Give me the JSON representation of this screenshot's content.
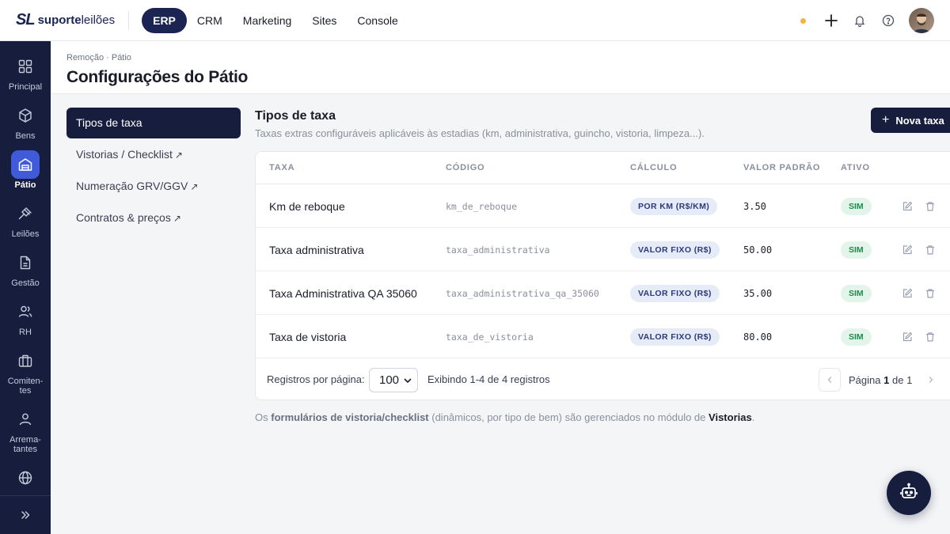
{
  "brand": {
    "mark": "SL",
    "name_bold": "suporte",
    "name_light": "leilões"
  },
  "topnav": {
    "items": [
      {
        "label": "ERP",
        "active": true
      },
      {
        "label": "CRM"
      },
      {
        "label": "Marketing"
      },
      {
        "label": "Sites"
      },
      {
        "label": "Console"
      }
    ]
  },
  "topbar_icons": [
    "status-dot",
    "plus-icon",
    "bell-icon",
    "help-icon",
    "avatar"
  ],
  "sidebar": {
    "items": [
      {
        "label": "Principal",
        "icon": "grid-icon"
      },
      {
        "label": "Bens",
        "icon": "box-icon"
      },
      {
        "label": "Pátio",
        "icon": "warehouse-icon",
        "active": true
      },
      {
        "label": "Leilões",
        "icon": "gavel-icon"
      },
      {
        "label": "Gestão",
        "icon": "document-icon"
      },
      {
        "label": "RH",
        "icon": "users-icon"
      },
      {
        "label": "Comiten-\ntes",
        "icon": "briefcase-icon"
      },
      {
        "label": "Arrema-\ntantes",
        "icon": "user-icon"
      },
      {
        "label": "",
        "icon": "globe-icon"
      }
    ],
    "expand_icon": "double-chevron-right-icon"
  },
  "page": {
    "breadcrumb": "Remoção · Pátio",
    "title": "Configurações do Pátio"
  },
  "submenu": {
    "items": [
      {
        "label": "Tipos de taxa",
        "active": true
      },
      {
        "label": "Vistorias / Checklist",
        "external": "↗"
      },
      {
        "label": "Numeração GRV/GGV",
        "external": "↗"
      },
      {
        "label": "Contratos & preços",
        "external": "↗"
      }
    ]
  },
  "content": {
    "title": "Tipos de taxa",
    "subtitle": "Taxas extras configuráveis aplicáveis às estadias (km, administrativa, guincho, vistoria, limpeza...).",
    "new_button": "Nova taxa"
  },
  "table": {
    "headers": [
      "TAXA",
      "CÓDIGO",
      "CÁLCULO",
      "VALOR PADRÃO",
      "ATIVO"
    ],
    "rows": [
      {
        "name": "Km de reboque",
        "code": "km_de_reboque",
        "calc": "POR KM (R$/KM)",
        "value": "3.50",
        "active": "SIM"
      },
      {
        "name": "Taxa administrativa",
        "code": "taxa_administrativa",
        "calc": "VALOR FIXO (R$)",
        "value": "50.00",
        "active": "SIM"
      },
      {
        "name": "Taxa Administrativa QA 35060",
        "code": "taxa_administrativa_qa_35060",
        "calc": "VALOR FIXO (R$)",
        "value": "35.00",
        "active": "SIM"
      },
      {
        "name": "Taxa de vistoria",
        "code": "taxa_de_vistoria",
        "calc": "VALOR FIXO (R$)",
        "value": "80.00",
        "active": "SIM"
      }
    ]
  },
  "pager": {
    "label": "Registros por página:",
    "per_page": "100",
    "info": "Exibindo 1-4 de 4 registros",
    "page_prefix": "Página",
    "page_current": "1",
    "page_sep": "de",
    "page_total": "1"
  },
  "footnote": {
    "part1": "Os ",
    "bold1": "formulários de vistoria/checklist",
    "part2": " (dinâmicos, por tipo de bem) são gerenciados no módulo de ",
    "link": "Vistorias",
    "part3": "."
  },
  "colors": {
    "brand_dark": "#161d3d",
    "accent_blue": "#3f5bd9",
    "status_green": "#1f8a4c",
    "status_dot": "#f3b53f"
  }
}
